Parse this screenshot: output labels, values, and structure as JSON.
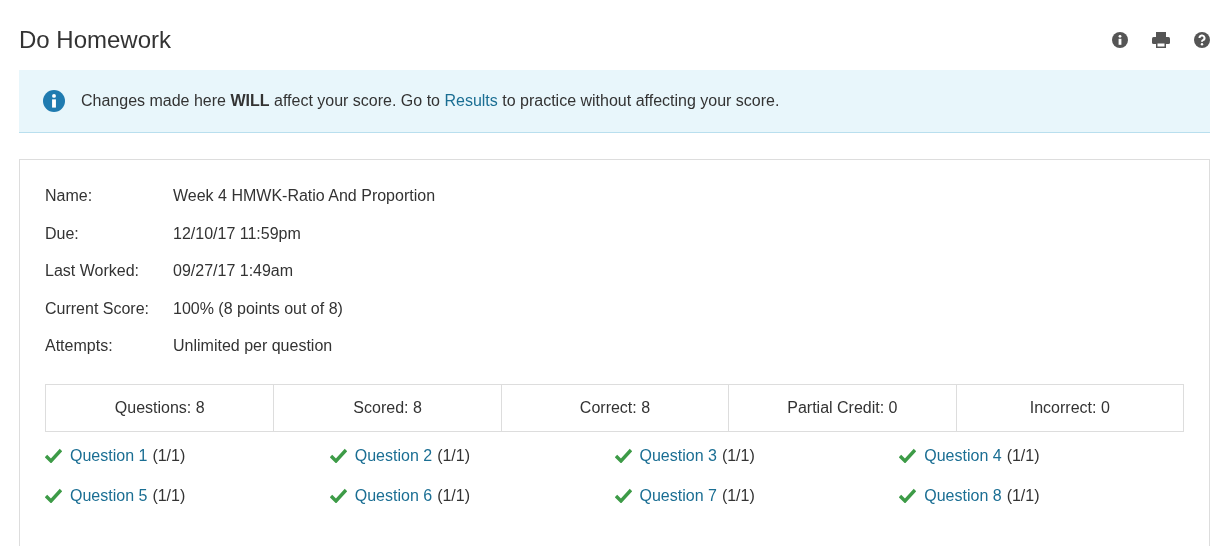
{
  "page_title": "Do Homework",
  "notice": {
    "before": "Changes made here **WILL** affect your score. Go to",
    "link": "Results",
    "after": "to practice without affecting your score."
  },
  "details": [
    {
      "label": "Name:",
      "value": "Week 4 HMWK-Ratio And Proportion"
    },
    {
      "label": "Due:",
      "value": "12/10/17 11:59pm"
    },
    {
      "label": "Last Worked:",
      "value": "09/27/17 1:49am"
    },
    {
      "label": "Current Score:",
      "value": "100% (8 points out of 8)"
    },
    {
      "label": "Attempts:",
      "value": "Unlimited per question"
    }
  ],
  "summary": [
    "Questions: 8",
    "Scored: 8",
    "Correct: 8",
    "Partial Credit: 0",
    "Incorrect: 0"
  ],
  "questions": [
    {
      "label": "Question 1",
      "score": "(1/1)",
      "correct": true
    },
    {
      "label": "Question 2",
      "score": "(1/1)",
      "correct": true
    },
    {
      "label": "Question 3",
      "score": "(1/1)",
      "correct": true
    },
    {
      "label": "Question 4",
      "score": "(1/1)",
      "correct": true
    },
    {
      "label": "Question 5",
      "score": "(1/1)",
      "correct": true
    },
    {
      "label": "Question 6",
      "score": "(1/1)",
      "correct": true
    },
    {
      "label": "Question 7",
      "score": "(1/1)",
      "correct": true
    },
    {
      "label": "Question 8",
      "score": "(1/1)",
      "correct": true
    }
  ]
}
